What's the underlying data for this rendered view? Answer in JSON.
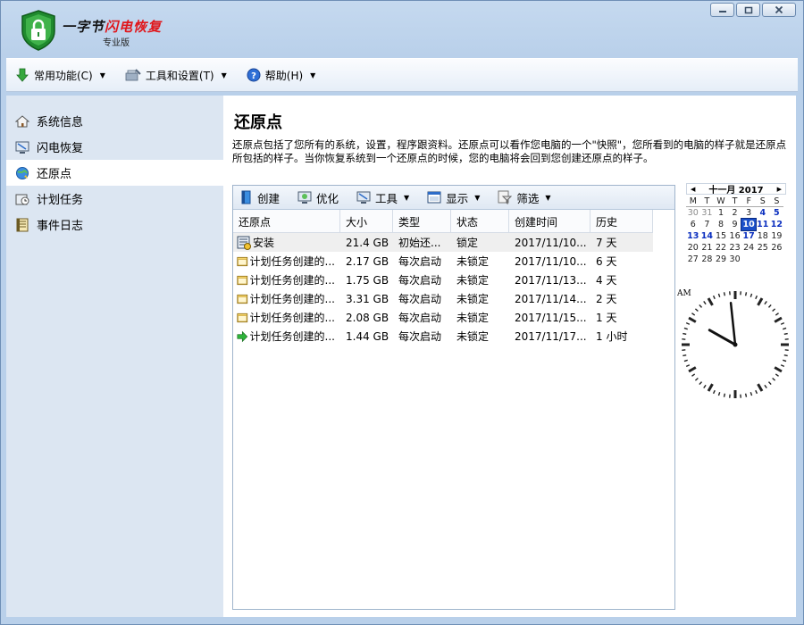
{
  "app": {
    "title_black": "一字节",
    "title_red": "闪电恢复",
    "subtitle": "专业版"
  },
  "menubar": [
    {
      "label": "常用功能(C)",
      "icon": "download-arrow-icon"
    },
    {
      "label": "工具和设置(T)",
      "icon": "tools-icon"
    },
    {
      "label": "帮助(H)",
      "icon": "help-icon"
    }
  ],
  "sidebar": {
    "items": [
      {
        "label": "系统信息",
        "icon": "home-icon"
      },
      {
        "label": "闪电恢复",
        "icon": "monitor-icon"
      },
      {
        "label": "还原点",
        "icon": "restore-globe-icon",
        "active": true
      },
      {
        "label": "计划任务",
        "icon": "schedule-icon"
      },
      {
        "label": "事件日志",
        "icon": "log-icon"
      }
    ]
  },
  "main": {
    "title": "还原点",
    "description": "还原点包括了您所有的系统，设置，程序跟资料。还原点可以看作您电脑的一个\"快照\"，您所看到的电脑的样子就是还原点所包括的样子。当你恢复系统到一个还原点的时候，您的电脑将会回到您创建还原点的样子。"
  },
  "toolbar": [
    {
      "label": "创建",
      "icon": "create-icon",
      "dropdown": false
    },
    {
      "label": "优化",
      "icon": "optimize-icon",
      "dropdown": false
    },
    {
      "label": "工具",
      "icon": "tools-icon",
      "dropdown": true
    },
    {
      "label": "显示",
      "icon": "display-icon",
      "dropdown": true
    },
    {
      "label": "筛选",
      "icon": "filter-icon",
      "dropdown": true
    }
  ],
  "table": {
    "columns": [
      "还原点",
      "大小",
      "类型",
      "状态",
      "创建时间",
      "历史"
    ],
    "rows": [
      {
        "name": "安装",
        "size": "21.4 GB",
        "type": "初始还...",
        "status": "锁定",
        "created": "2017/11/10...",
        "history": "7 天",
        "icon": "install-icon"
      },
      {
        "name": "计划任务创建的...",
        "size": "2.17 GB",
        "type": "每次启动",
        "status": "未锁定",
        "created": "2017/11/10...",
        "history": "6 天",
        "icon": "folder-icon"
      },
      {
        "name": "计划任务创建的...",
        "size": "1.75 GB",
        "type": "每次启动",
        "status": "未锁定",
        "created": "2017/11/13...",
        "history": "4 天",
        "icon": "folder-icon"
      },
      {
        "name": "计划任务创建的...",
        "size": "3.31 GB",
        "type": "每次启动",
        "status": "未锁定",
        "created": "2017/11/14...",
        "history": "2 天",
        "icon": "folder-icon"
      },
      {
        "name": "计划任务创建的...",
        "size": "2.08 GB",
        "type": "每次启动",
        "status": "未锁定",
        "created": "2017/11/15...",
        "history": "1 天",
        "icon": "folder-icon"
      },
      {
        "name": "计划任务创建的...",
        "size": "1.44 GB",
        "type": "每次启动",
        "status": "未锁定",
        "created": "2017/11/17...",
        "history": "1 小时",
        "icon": "current-arrow-icon"
      }
    ]
  },
  "calendar": {
    "title": "十一月 2017",
    "prev": "◀",
    "next": "▶",
    "weekdays": [
      "M",
      "T",
      "W",
      "T",
      "F",
      "S",
      "S"
    ],
    "days": [
      "30",
      "31",
      "1",
      "2",
      "3",
      "4",
      "5",
      "6",
      "7",
      "8",
      "9",
      "10",
      "11",
      "12",
      "13",
      "14",
      "15",
      "16",
      "17",
      "18",
      "19",
      "20",
      "21",
      "22",
      "23",
      "24",
      "25",
      "26",
      "27",
      "28",
      "29",
      "30"
    ],
    "first_weekday_offset": 0,
    "today": "10",
    "weekend_highlight": [
      "4",
      "5",
      "11",
      "12",
      "13",
      "14",
      "17"
    ]
  },
  "clock": {
    "label": "AM",
    "hour": 9,
    "minute": 59
  },
  "colors": {
    "accent": "#1a4fc8",
    "brand_red": "#e0161b",
    "sidebar_bg": "#dce6f2"
  }
}
